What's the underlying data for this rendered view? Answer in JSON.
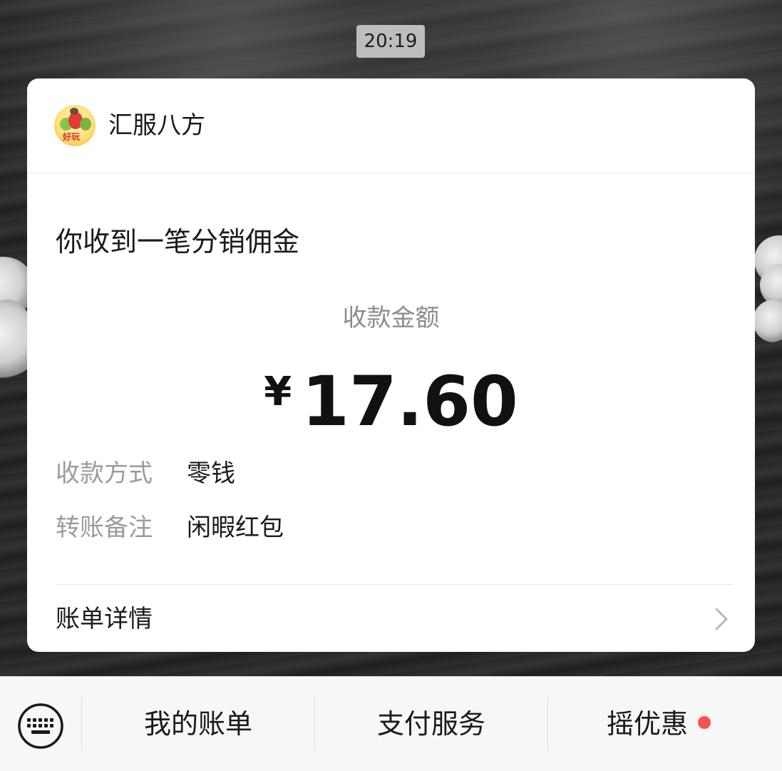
{
  "chat": {
    "timestamp": "20:19"
  },
  "card": {
    "sender_name": "汇服八方",
    "avatar_icon": "fruit-logo-icon",
    "avatar_text": "好玩",
    "title": "你收到一笔分销佣金",
    "amount_label": "收款金额",
    "currency_symbol": "¥",
    "amount": "17.60",
    "details": [
      {
        "key": "收款方式",
        "value": "零钱"
      },
      {
        "key": "转账备注",
        "value": "闲暇红包"
      }
    ],
    "bill_detail_label": "账单详情",
    "bill_detail_icon": "chevron-right-icon"
  },
  "bottom_menu": {
    "keyboard_icon": "keyboard-icon",
    "items": [
      {
        "label": "我的账单"
      },
      {
        "label": "支付服务"
      },
      {
        "label": "摇优惠",
        "badge_color": "#fa5151"
      }
    ]
  },
  "colors": {
    "card_bg": "#ffffff",
    "secondary_text": "#9b9b9b",
    "primary_text": "#1a1a1a",
    "badge_red": "#fa5151"
  }
}
